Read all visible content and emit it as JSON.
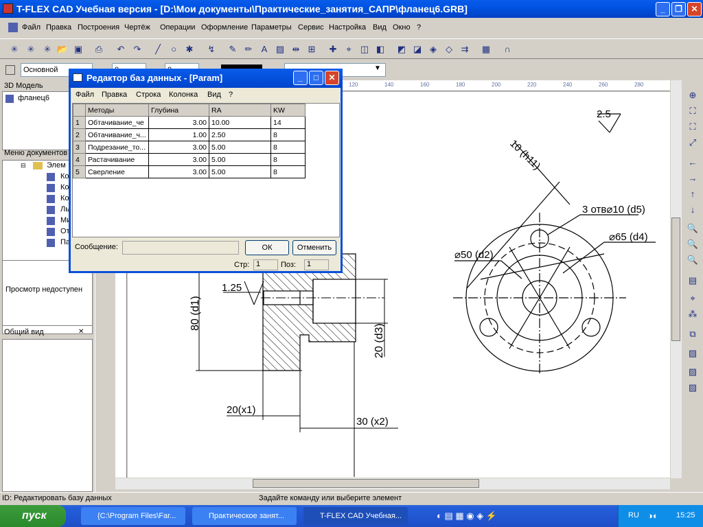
{
  "window": {
    "title": "T-FLEX CAD Учебная версия - [D:\\Мои документы\\Практические_занятия_САПР\\фланец6.GRB]"
  },
  "menu": [
    "Файл",
    "Правка",
    "Построения",
    "Чертёж",
    "Операции",
    "Оформление",
    "Параметры",
    "Сервис",
    "Настройка",
    "Вид",
    "Окно",
    "?"
  ],
  "toolbar2": {
    "layer": "Основной",
    "v1": "0",
    "v2": "0"
  },
  "model_panel": {
    "title": "3D Модель",
    "item": "фланец6"
  },
  "doc_menu": {
    "title": "Меню документов",
    "root": "Элем",
    "items": [
      "Ко",
      "Ко",
      "Ко",
      "Ль",
      "Ми",
      "От",
      "Па"
    ]
  },
  "preview": {
    "text": "Просмотр недоступен"
  },
  "overview": {
    "title": "Общий вид"
  },
  "ruler": [
    "120",
    "140",
    "160",
    "180",
    "200",
    "220",
    "240",
    "260",
    "280"
  ],
  "drawing": {
    "dims": [
      "2.5",
      "10 (h11)",
      "3 отв⌀10 (d5)",
      "⌀65 (d4)",
      "⌀50 (d2)",
      "1.25",
      "80 (d1)",
      "20 (d3)",
      "20(x1)",
      "30 (x2)"
    ]
  },
  "dialog": {
    "title": "Редактор баз данных - [Param]",
    "menu": [
      "Файл",
      "Правка",
      "Строка",
      "Колонка",
      "Вид",
      "?"
    ],
    "columns": [
      "Методы",
      "Глубина",
      "RA",
      "KW"
    ],
    "rows": [
      [
        "1",
        "Обтачивание_че",
        "3.00",
        "10.00",
        "14"
      ],
      [
        "2",
        "Обтачивание_ч...",
        "1.00",
        "2.50",
        "8"
      ],
      [
        "3",
        "Подрезание_то...",
        "3.00",
        "5.00",
        "8"
      ],
      [
        "4",
        "Растачивание",
        "3.00",
        "5.00",
        "8"
      ],
      [
        "5",
        "Сверление",
        "3.00",
        "5.00",
        "8"
      ]
    ],
    "message_label": "Сообщение:",
    "ok": "ОК",
    "cancel": "Отменить",
    "page_label": "Стр:",
    "page": "1",
    "pos_label": "Поз:",
    "pos": "1"
  },
  "status": {
    "left": "ID: Редактировать базу данных",
    "right": "Задайте команду или выберите элемент"
  },
  "taskbar": {
    "start": "пуск",
    "tasks": [
      "{C:\\Program Files\\Far...",
      "Практическое занят...",
      "T-FLEX CAD Учебная..."
    ],
    "lang": "RU",
    "time": "15:25"
  }
}
